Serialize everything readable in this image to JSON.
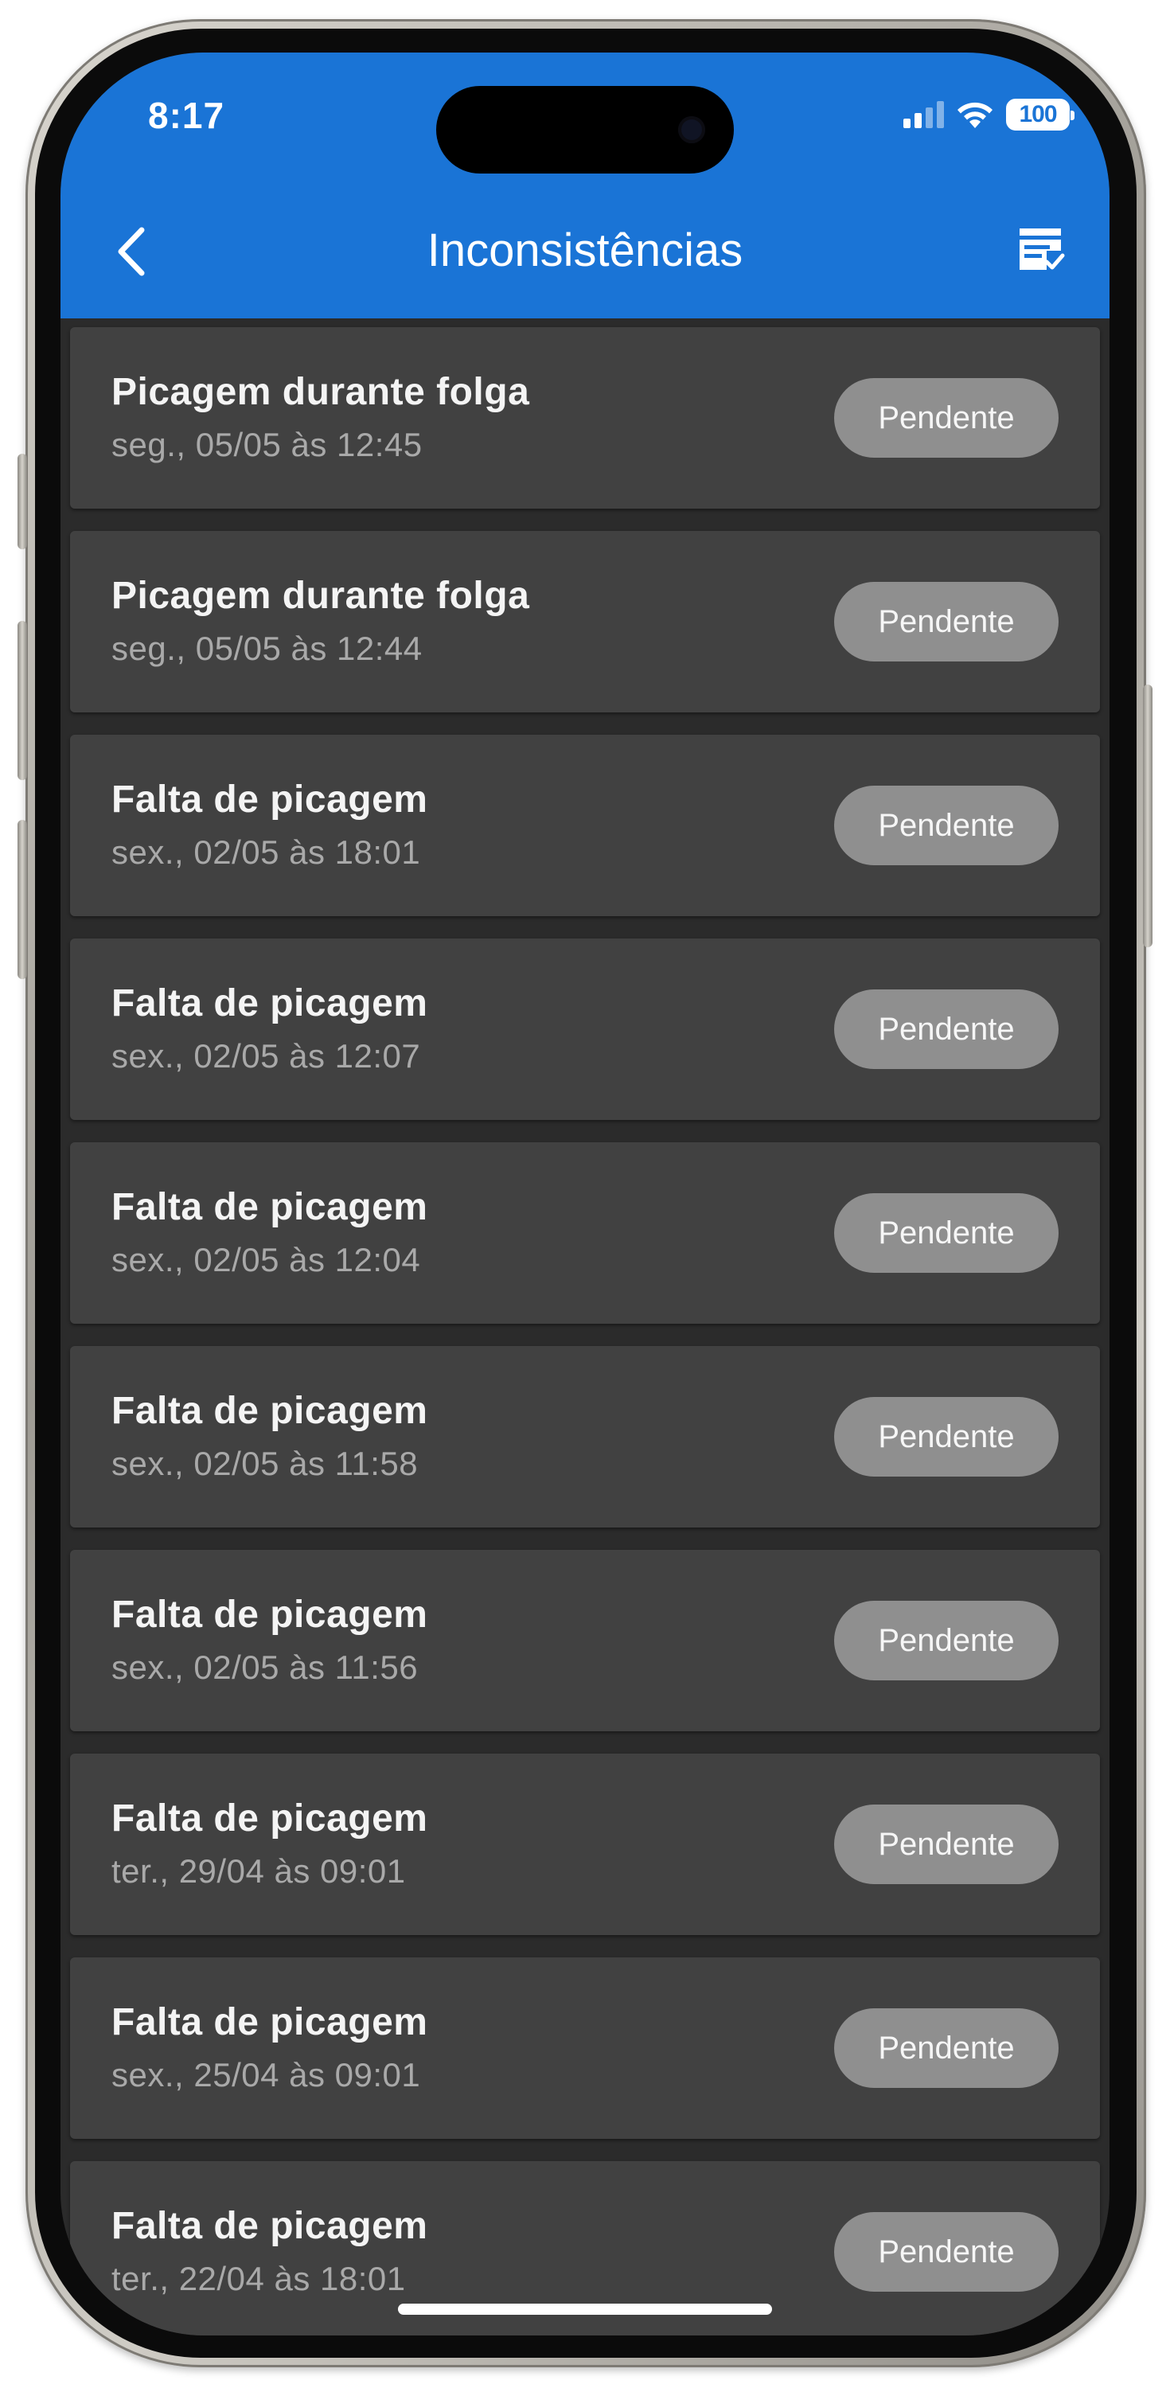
{
  "status_bar": {
    "time": "8:17",
    "battery": "100"
  },
  "header": {
    "title": "Inconsistências",
    "background": "#1a74d6",
    "back_icon": "chevron-left-icon",
    "action_icon": "form-check-icon"
  },
  "items": [
    {
      "title": "Picagem durante folga",
      "subtitle": "seg., 05/05 às 12:45",
      "status": "Pendente"
    },
    {
      "title": "Picagem durante folga",
      "subtitle": "seg., 05/05 às 12:44",
      "status": "Pendente"
    },
    {
      "title": "Falta de picagem",
      "subtitle": "sex., 02/05 às 18:01",
      "status": "Pendente"
    },
    {
      "title": "Falta de picagem",
      "subtitle": "sex., 02/05 às 12:07",
      "status": "Pendente"
    },
    {
      "title": "Falta de picagem",
      "subtitle": "sex., 02/05 às 12:04",
      "status": "Pendente"
    },
    {
      "title": "Falta de picagem",
      "subtitle": "sex., 02/05 às 11:58",
      "status": "Pendente"
    },
    {
      "title": "Falta de picagem",
      "subtitle": "sex., 02/05 às 11:56",
      "status": "Pendente"
    },
    {
      "title": "Falta de picagem",
      "subtitle": "ter., 29/04 às 09:01",
      "status": "Pendente"
    },
    {
      "title": "Falta de picagem",
      "subtitle": "sex., 25/04 às 09:01",
      "status": "Pendente"
    },
    {
      "title": "Falta de picagem",
      "subtitle": "ter., 22/04 às 18:01",
      "status": "Pendente"
    }
  ]
}
